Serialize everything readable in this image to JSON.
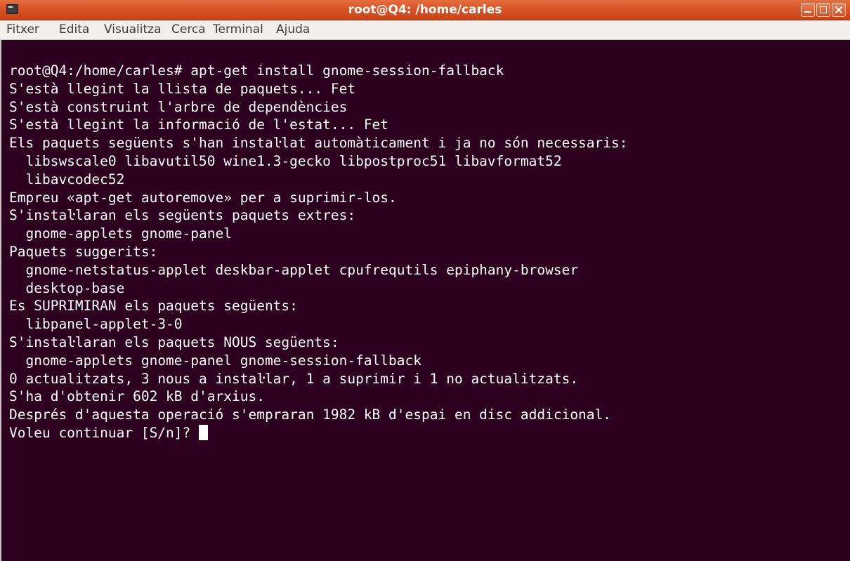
{
  "window": {
    "title": "root@Q4: /home/carles",
    "icon": "terminal-icon"
  },
  "menu": {
    "items": [
      "Fitxer",
      "Edita",
      "Visualitza",
      "Cerca",
      "Terminal",
      "Ajuda"
    ]
  },
  "terminal": {
    "lines": [
      "root@Q4:/home/carles# apt-get install gnome-session-fallback",
      "S'està llegint la llista de paquets... Fet",
      "S'està construint l'arbre de dependències",
      "S'està llegint la informació de l'estat... Fet",
      "Els paquets següents s'han instaŀlat automàticament i ja no són necessaris:",
      "  libswscale0 libavutil50 wine1.3-gecko libpostproc51 libavformat52",
      "  libavcodec52",
      "Empreu «apt-get autoremove» per a suprimir-los.",
      "S'instaŀlaran els següents paquets extres:",
      "  gnome-applets gnome-panel",
      "Paquets suggerits:",
      "  gnome-netstatus-applet deskbar-applet cpufrequtils epiphany-browser",
      "  desktop-base",
      "Es SUPRIMIRAN els paquets següents:",
      "  libpanel-applet-3-0",
      "S'instaŀlaran els paquets NOUS següents:",
      "  gnome-applets gnome-panel gnome-session-fallback",
      "0 actualitzats, 3 nous a instaŀlar, 1 a suprimir i 1 no actualitzats.",
      "S'ha d'obtenir 602 kB d'arxius.",
      "Després d'aquesta operació s'empraran 1982 kB d'espai en disc addicional."
    ],
    "prompt": "Voleu continuar [S/n]? "
  },
  "colors": {
    "background": "#2c001e",
    "text": "#ffffff",
    "titlebar": "#d95426",
    "menubar": "#f0efee"
  }
}
